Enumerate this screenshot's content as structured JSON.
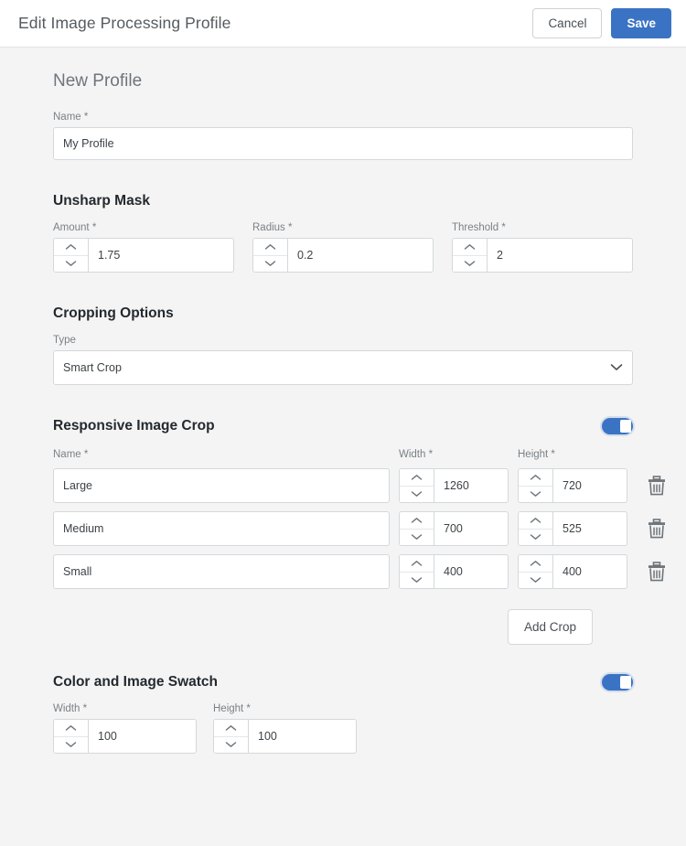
{
  "header": {
    "title": "Edit Image Processing Profile",
    "cancel_label": "Cancel",
    "save_label": "Save"
  },
  "profile": {
    "heading": "New Profile",
    "name_label": "Name *",
    "name_value": "My Profile"
  },
  "unsharp_mask": {
    "title": "Unsharp Mask",
    "amount_label": "Amount *",
    "amount_value": "1.75",
    "radius_label": "Radius *",
    "radius_value": "0.2",
    "threshold_label": "Threshold *",
    "threshold_value": "2"
  },
  "cropping_options": {
    "title": "Cropping Options",
    "type_label": "Type",
    "type_value": "Smart Crop"
  },
  "responsive_image_crop": {
    "title": "Responsive Image Crop",
    "enabled": "on",
    "name_label": "Name *",
    "width_label": "Width *",
    "height_label": "Height *",
    "add_crop_label": "Add Crop",
    "rows": [
      {
        "name": "Large",
        "width": "1260",
        "height": "720"
      },
      {
        "name": "Medium",
        "width": "700",
        "height": "525"
      },
      {
        "name": "Small",
        "width": "400",
        "height": "400"
      }
    ]
  },
  "color_image_swatch": {
    "title": "Color and Image Swatch",
    "enabled": "on",
    "width_label": "Width *",
    "width_value": "100",
    "height_label": "Height *",
    "height_value": "100"
  },
  "colors": {
    "primary": "#3b73c4",
    "page_background": "#f4f4f4",
    "header_background": "#ffffff",
    "border": "#d4d8dc",
    "label_text": "#7b8186"
  }
}
